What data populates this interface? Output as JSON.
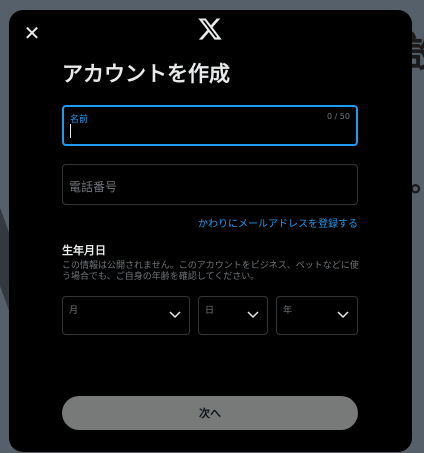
{
  "background": {
    "chars": [
      "設",
      "。"
    ]
  },
  "modal": {
    "title": "アカウントを作成",
    "name_field": {
      "label": "名前",
      "counter": "0 / 50",
      "value": ""
    },
    "phone_field": {
      "placeholder": "電話番号"
    },
    "use_email_link": "かわりにメールアドレスを登録する",
    "dob": {
      "title": "生年月日",
      "description": "この情報は公開されません。このアカウントをビジネス、ペットなどに使う場合でも、ご自身の年齢を確認してください。",
      "month_label": "月",
      "day_label": "日",
      "year_label": "年"
    },
    "next_button": "次へ"
  },
  "colors": {
    "accent": "#1d9bf0",
    "modal_bg": "#000000",
    "button_bg": "#787a7a"
  },
  "icons": {
    "close": "close-icon",
    "logo": "x-logo-icon",
    "chevron": "chevron-down-icon"
  }
}
